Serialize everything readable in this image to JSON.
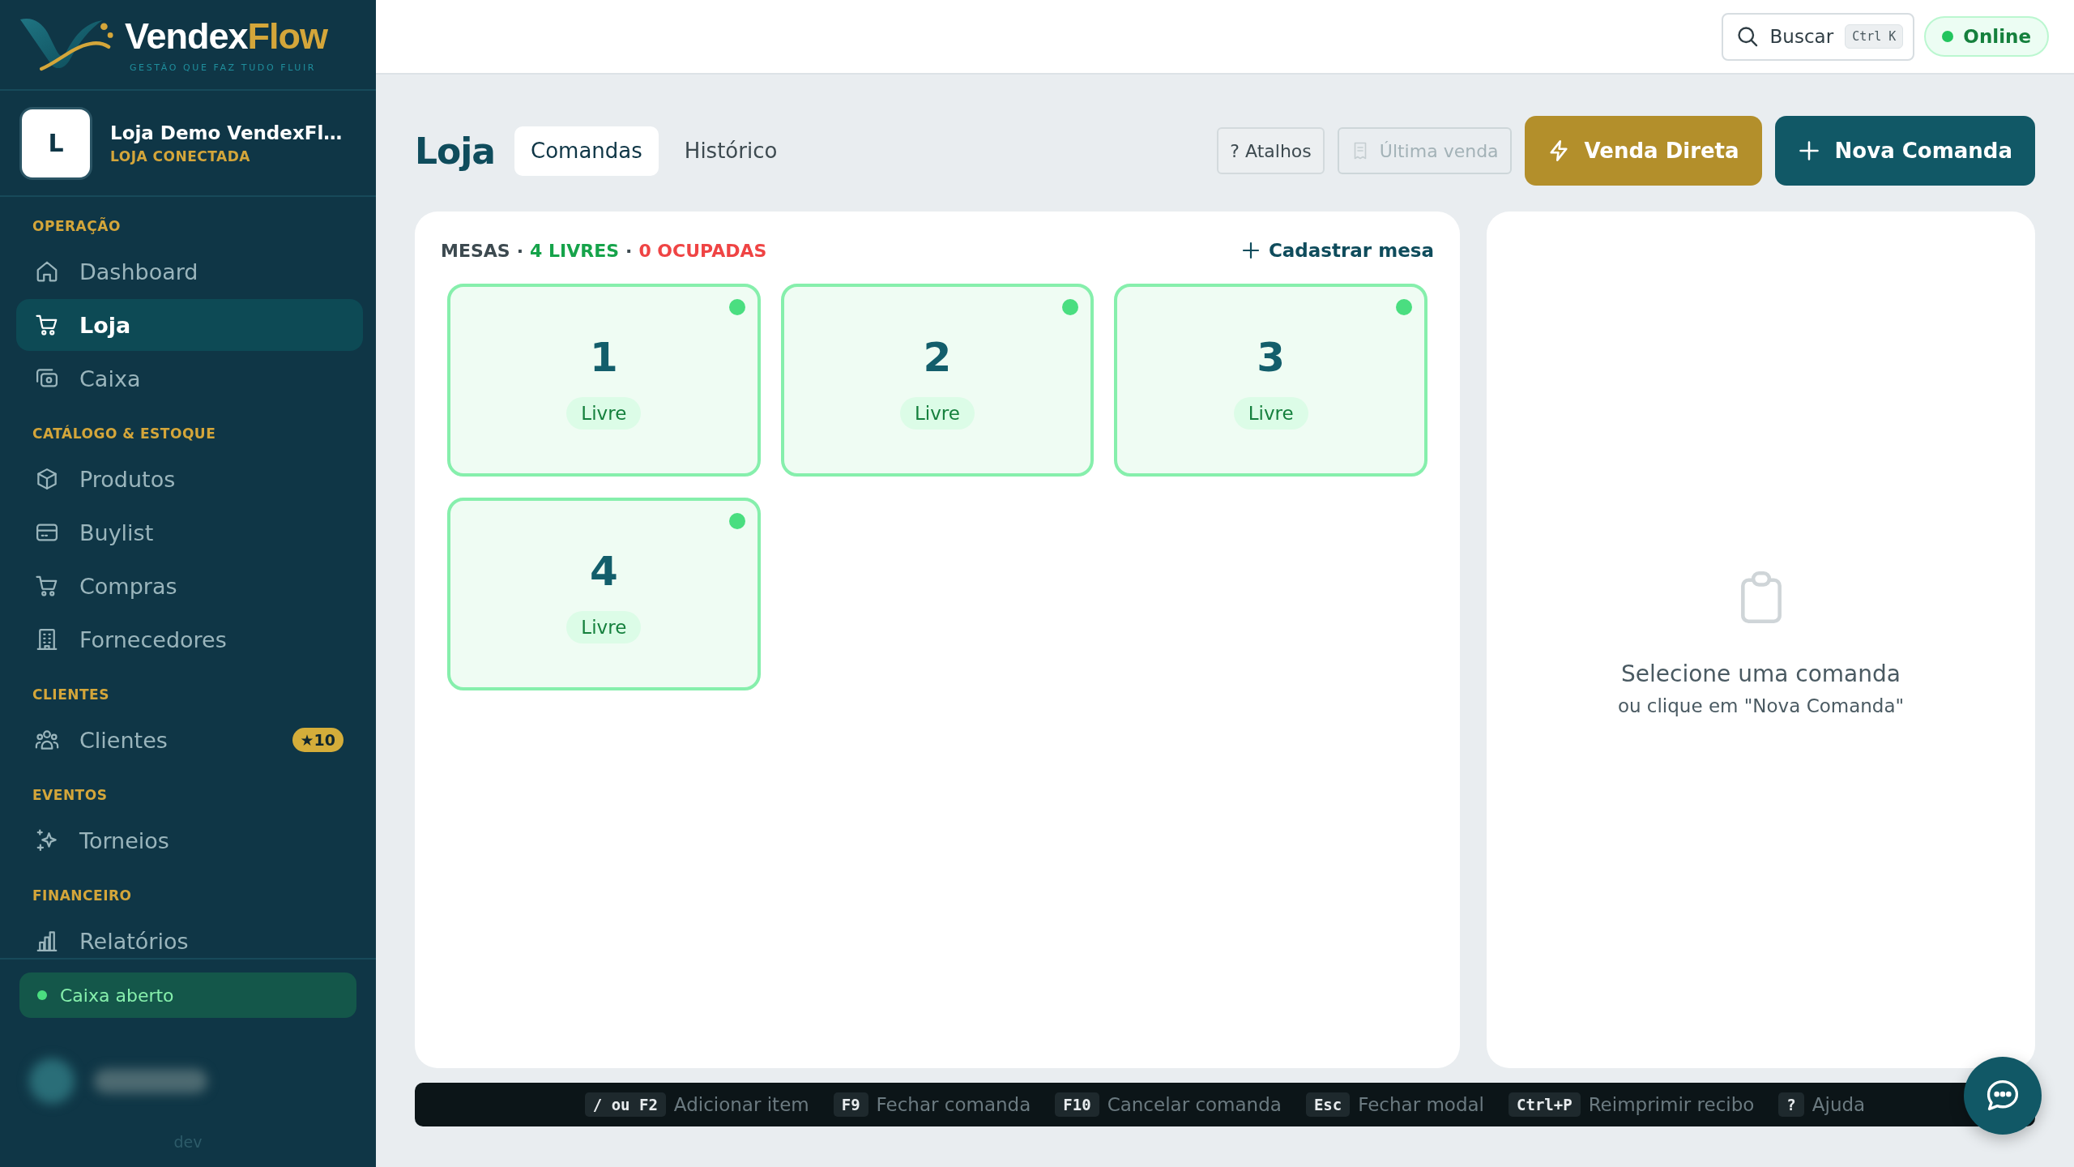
{
  "sidebar": {
    "brand": {
      "name_start": "Vendex",
      "name_end": "Flow",
      "tagline": "GESTÃO QUE FAZ TUDO FLUIR"
    },
    "store": {
      "initial": "L",
      "name": "Loja Demo VendexFl…",
      "status": "LOJA CONECTADA"
    },
    "sections": [
      {
        "title": "OPERAÇÃO",
        "items": [
          {
            "label": "Dashboard",
            "selected": false
          },
          {
            "label": "Loja",
            "selected": true
          },
          {
            "label": "Caixa",
            "selected": false
          }
        ]
      },
      {
        "title": "CATÁLOGO & ESTOQUE",
        "items": [
          {
            "label": "Produtos",
            "selected": false
          },
          {
            "label": "Buylist",
            "selected": false
          },
          {
            "label": "Compras",
            "selected": false
          },
          {
            "label": "Fornecedores",
            "selected": false
          }
        ]
      },
      {
        "title": "CLIENTES",
        "items": [
          {
            "label": "Clientes",
            "selected": false,
            "badge": "★10"
          }
        ]
      },
      {
        "title": "EVENTOS",
        "items": [
          {
            "label": "Torneios",
            "selected": false
          }
        ]
      },
      {
        "title": "FINANCEIRO",
        "items": [
          {
            "label": "Relatórios",
            "selected": false
          }
        ]
      }
    ],
    "cash_status": {
      "label": "Caixa aberto",
      "open": true
    },
    "version": "dev"
  },
  "top_bar": {
    "search": {
      "label": "Buscar",
      "shortcut": "Ctrl K"
    },
    "connection": {
      "label": "Online",
      "online": true
    }
  },
  "page": {
    "title": "Loja",
    "tabs": [
      {
        "label": "Comandas",
        "selected": true
      },
      {
        "label": "Histórico",
        "selected": false
      }
    ],
    "actions": [
      {
        "label": "? Atalhos",
        "kind": "outline",
        "disabled": false
      },
      {
        "label": "Última venda",
        "kind": "outline",
        "disabled": true
      },
      {
        "label": "Venda Direta",
        "kind": "accent",
        "disabled": false
      },
      {
        "label": "Nova Comanda",
        "kind": "primary",
        "disabled": false
      }
    ]
  },
  "tables_panel": {
    "summary": [
      {
        "kind": "label",
        "text": "MESAS"
      },
      {
        "kind": "separator",
        "text": "·"
      },
      {
        "kind": "free",
        "text": "4 LIVRES"
      },
      {
        "kind": "separator",
        "text": "·"
      },
      {
        "kind": "occupied",
        "text": "0 OCUPADAS"
      }
    ],
    "add_button": "Cadastrar mesa",
    "tables": [
      {
        "number": "1",
        "status": "Livre",
        "occupied": false
      },
      {
        "number": "2",
        "status": "Livre",
        "occupied": false
      },
      {
        "number": "3",
        "status": "Livre",
        "occupied": false
      },
      {
        "number": "4",
        "status": "Livre",
        "occupied": false
      }
    ]
  },
  "detail_panel": {
    "title": "Selecione uma comanda",
    "hint": "ou clique em \"Nova Comanda\""
  },
  "shortcuts": [
    {
      "keys": "/ ou F2",
      "action": "Adicionar item"
    },
    {
      "keys": "F9",
      "action": "Fechar comanda"
    },
    {
      "keys": "F10",
      "action": "Cancelar comanda"
    },
    {
      "keys": "Esc",
      "action": "Fechar modal"
    },
    {
      "keys": "Ctrl+P",
      "action": "Reimprimir recibo"
    },
    {
      "keys": "?",
      "action": "Ajuda"
    }
  ]
}
